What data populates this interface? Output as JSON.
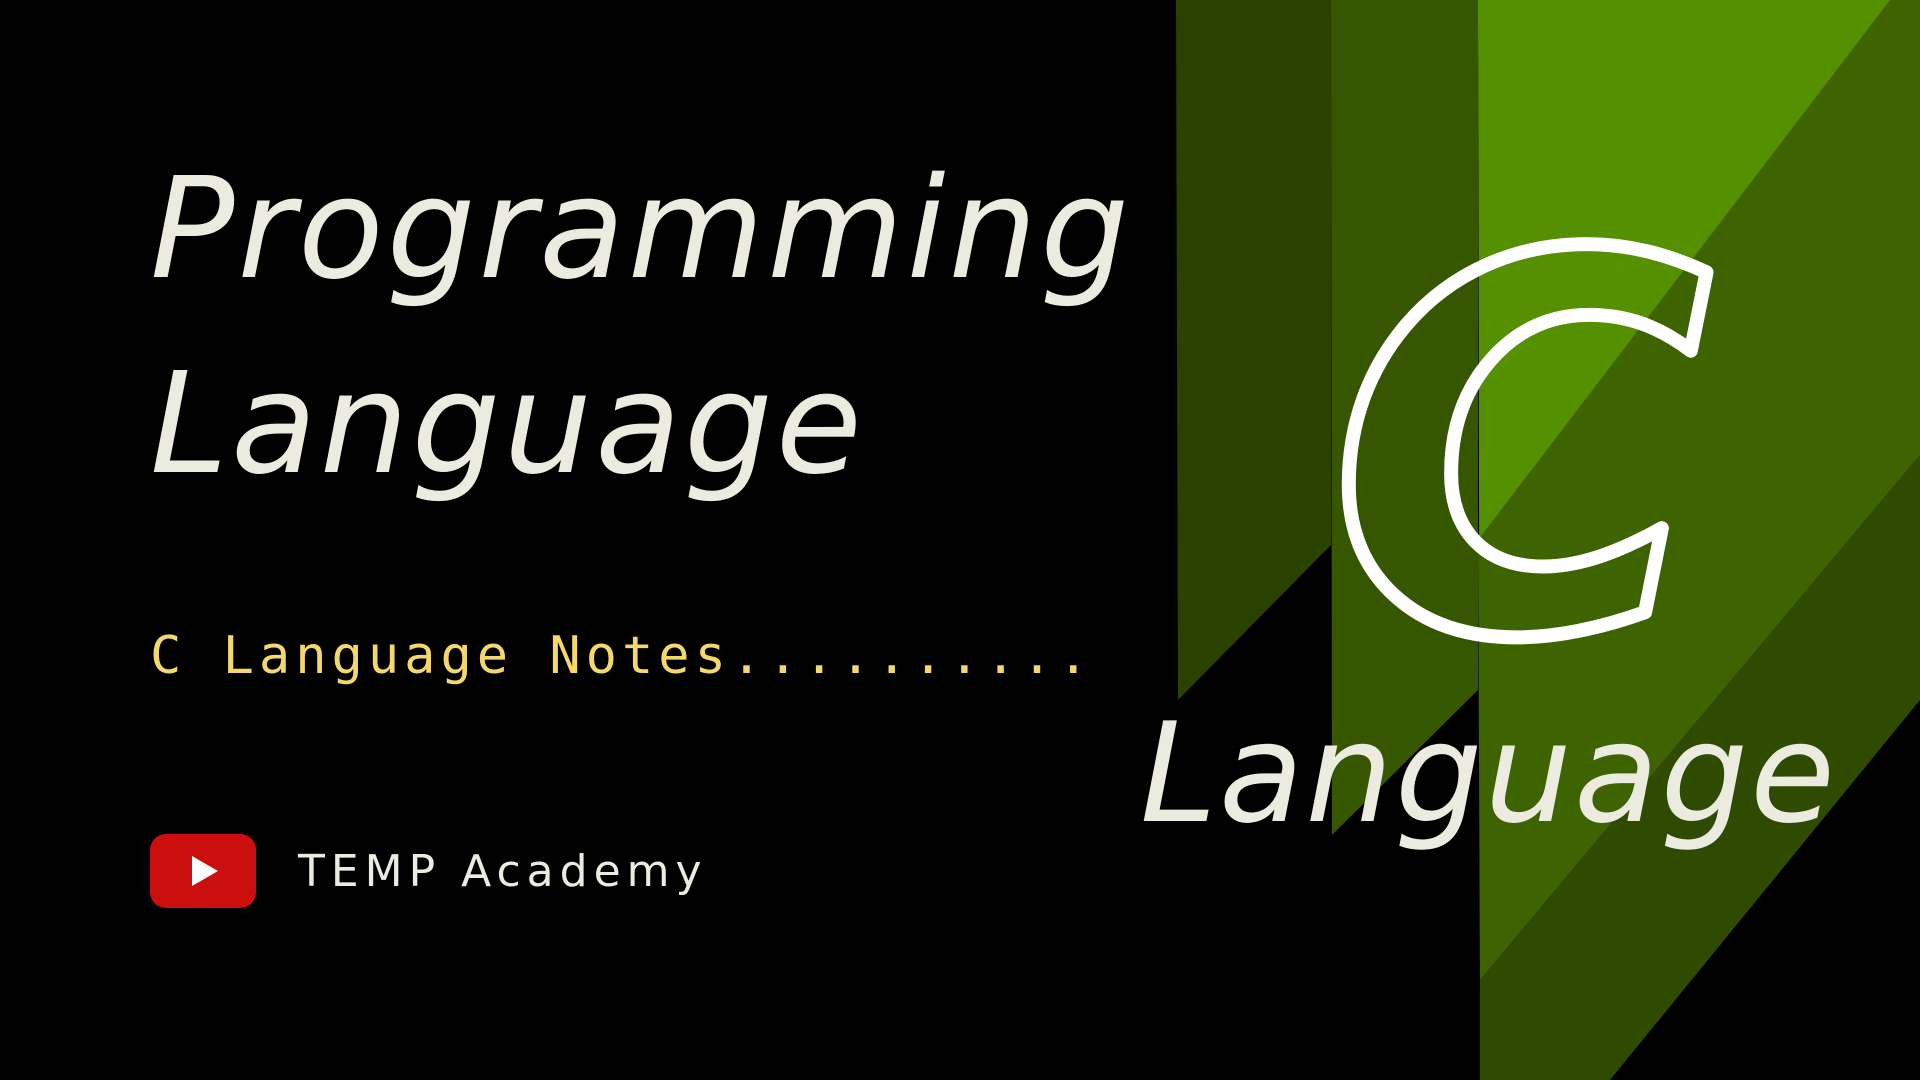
{
  "headline": {
    "line1": "Programming",
    "line2": "Language"
  },
  "subtitle": "C Language Notes..........",
  "channel": {
    "name": "TEMP Academy",
    "logo_icon": "youtube-play-icon"
  },
  "badge": {
    "letter": "C",
    "label": "Language"
  },
  "colors": {
    "background": "#000000",
    "text_light": "#ecebdf",
    "subtitle_yellow": "#f4d86a",
    "youtube_red": "#cc0e0e",
    "stripe_dark": "#2a4100",
    "stripe_mid": "#375602",
    "stripe_light": "#558f02"
  }
}
